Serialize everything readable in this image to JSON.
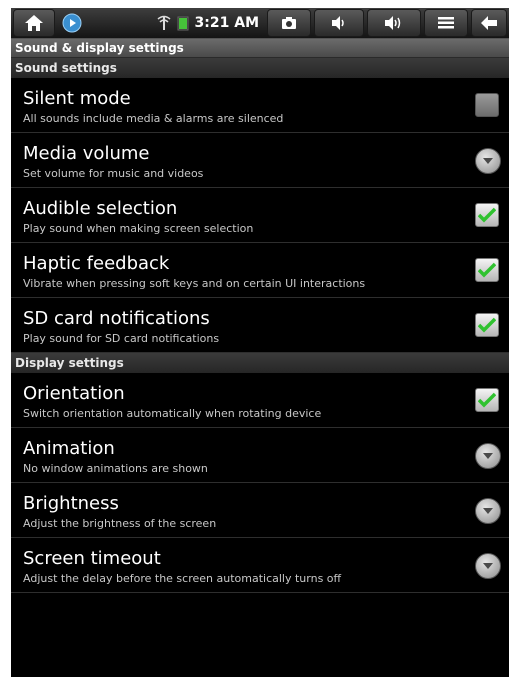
{
  "status_bar": {
    "time": "3:21 AM",
    "icons": [
      "home-icon",
      "play-icon",
      "wifi-icon",
      "battery-icon",
      "camera-icon",
      "volume-down-icon",
      "volume-up-icon",
      "menu-icon",
      "back-icon"
    ]
  },
  "title": "Sound & display settings",
  "sections": {
    "sound": {
      "label": "Sound settings",
      "items": [
        {
          "title": "Silent mode",
          "subtitle": "All sounds include media & alarms are silenced",
          "control": "checkbox",
          "checked": false,
          "enabled": false
        },
        {
          "title": "Media volume",
          "subtitle": "Set volume for music and videos",
          "control": "arrow"
        },
        {
          "title": "Audible selection",
          "subtitle": "Play sound when making screen selection",
          "control": "checkbox",
          "checked": true
        },
        {
          "title": "Haptic feedback",
          "subtitle": "Vibrate when pressing soft keys and on certain UI interactions",
          "control": "checkbox",
          "checked": true
        },
        {
          "title": "SD card notifications",
          "subtitle": "Play sound for SD card notifications",
          "control": "checkbox",
          "checked": true
        }
      ]
    },
    "display": {
      "label": "Display settings",
      "items": [
        {
          "title": "Orientation",
          "subtitle": "Switch orientation automatically when rotating device",
          "control": "checkbox",
          "checked": true
        },
        {
          "title": "Animation",
          "subtitle": "No window animations are shown",
          "control": "arrow"
        },
        {
          "title": "Brightness",
          "subtitle": "Adjust the brightness of the screen",
          "control": "arrow"
        },
        {
          "title": "Screen timeout",
          "subtitle": "Adjust the delay before the screen automatically turns off",
          "control": "arrow"
        }
      ]
    }
  },
  "colors": {
    "check": "#3bd43b",
    "background": "#000000"
  }
}
